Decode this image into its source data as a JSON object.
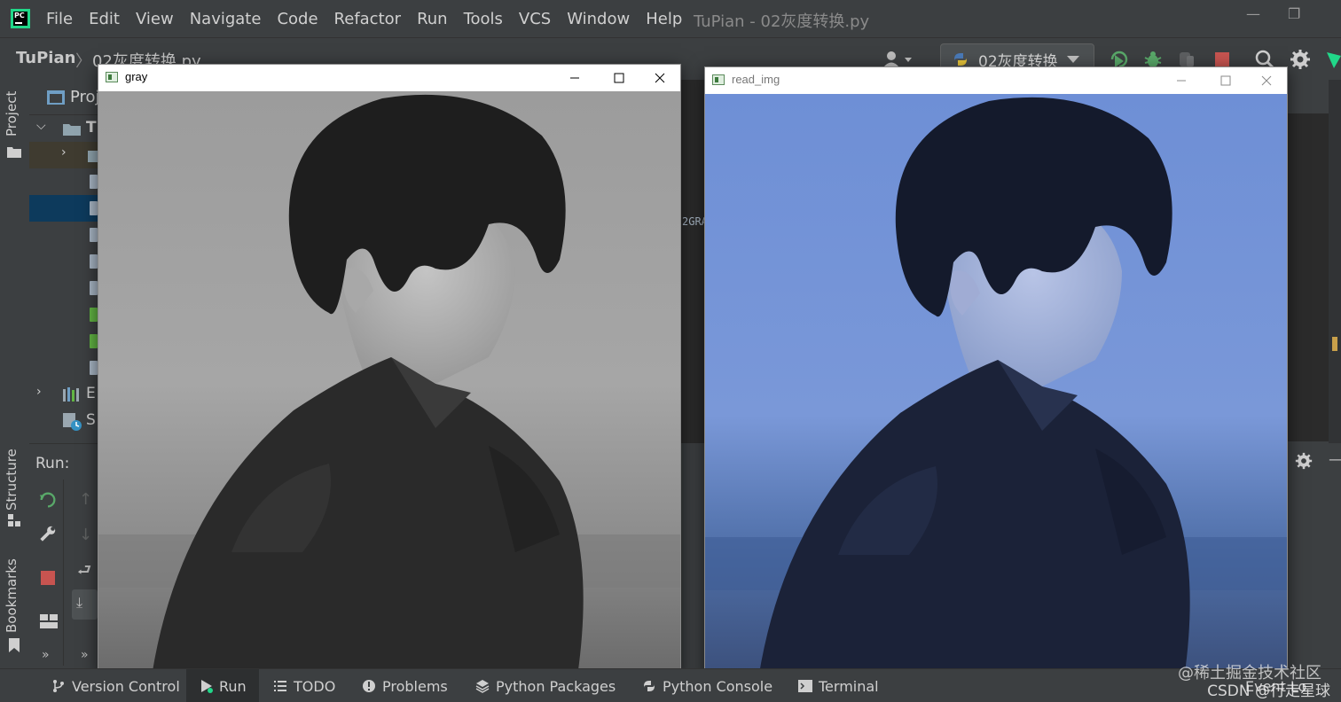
{
  "menubar": {
    "logo_text": "PC",
    "items": [
      "File",
      "Edit",
      "View",
      "Navigate",
      "Code",
      "Refactor",
      "Run",
      "Tools",
      "VCS",
      "Window",
      "Help"
    ],
    "window_title": "TuPian - 02灰度转换.py"
  },
  "navbar": {
    "project": "TuPian",
    "file": "02灰度转换.py",
    "run_config": "02灰度转换"
  },
  "left_stripe": {
    "project_tab": "Project",
    "structure_tab": "Structure",
    "bookmarks_tab": "Bookmarks"
  },
  "project_panel": {
    "header": "Proj",
    "root": "T",
    "external": "E",
    "scratches": "S"
  },
  "run_panel": {
    "label": "Run:"
  },
  "editor": {
    "code_fragment": "2GRA"
  },
  "bottom_bar": {
    "items": [
      "Version Control",
      "Run",
      "TODO",
      "Problems",
      "Python Packages",
      "Python Console",
      "Terminal"
    ],
    "event_log_partial": "Event Lo"
  },
  "watermark": {
    "line1": "@稀土掘金技术社区",
    "line2": "CSDN @行走星球"
  },
  "windows": {
    "gray": {
      "title": "gray"
    },
    "read_img": {
      "title": "read_img"
    }
  },
  "colors": {
    "accent_green": "#21d789",
    "stop_red": "#c75450",
    "selection": "#0d3a5c",
    "sky_blue": "#6e8fd6"
  }
}
